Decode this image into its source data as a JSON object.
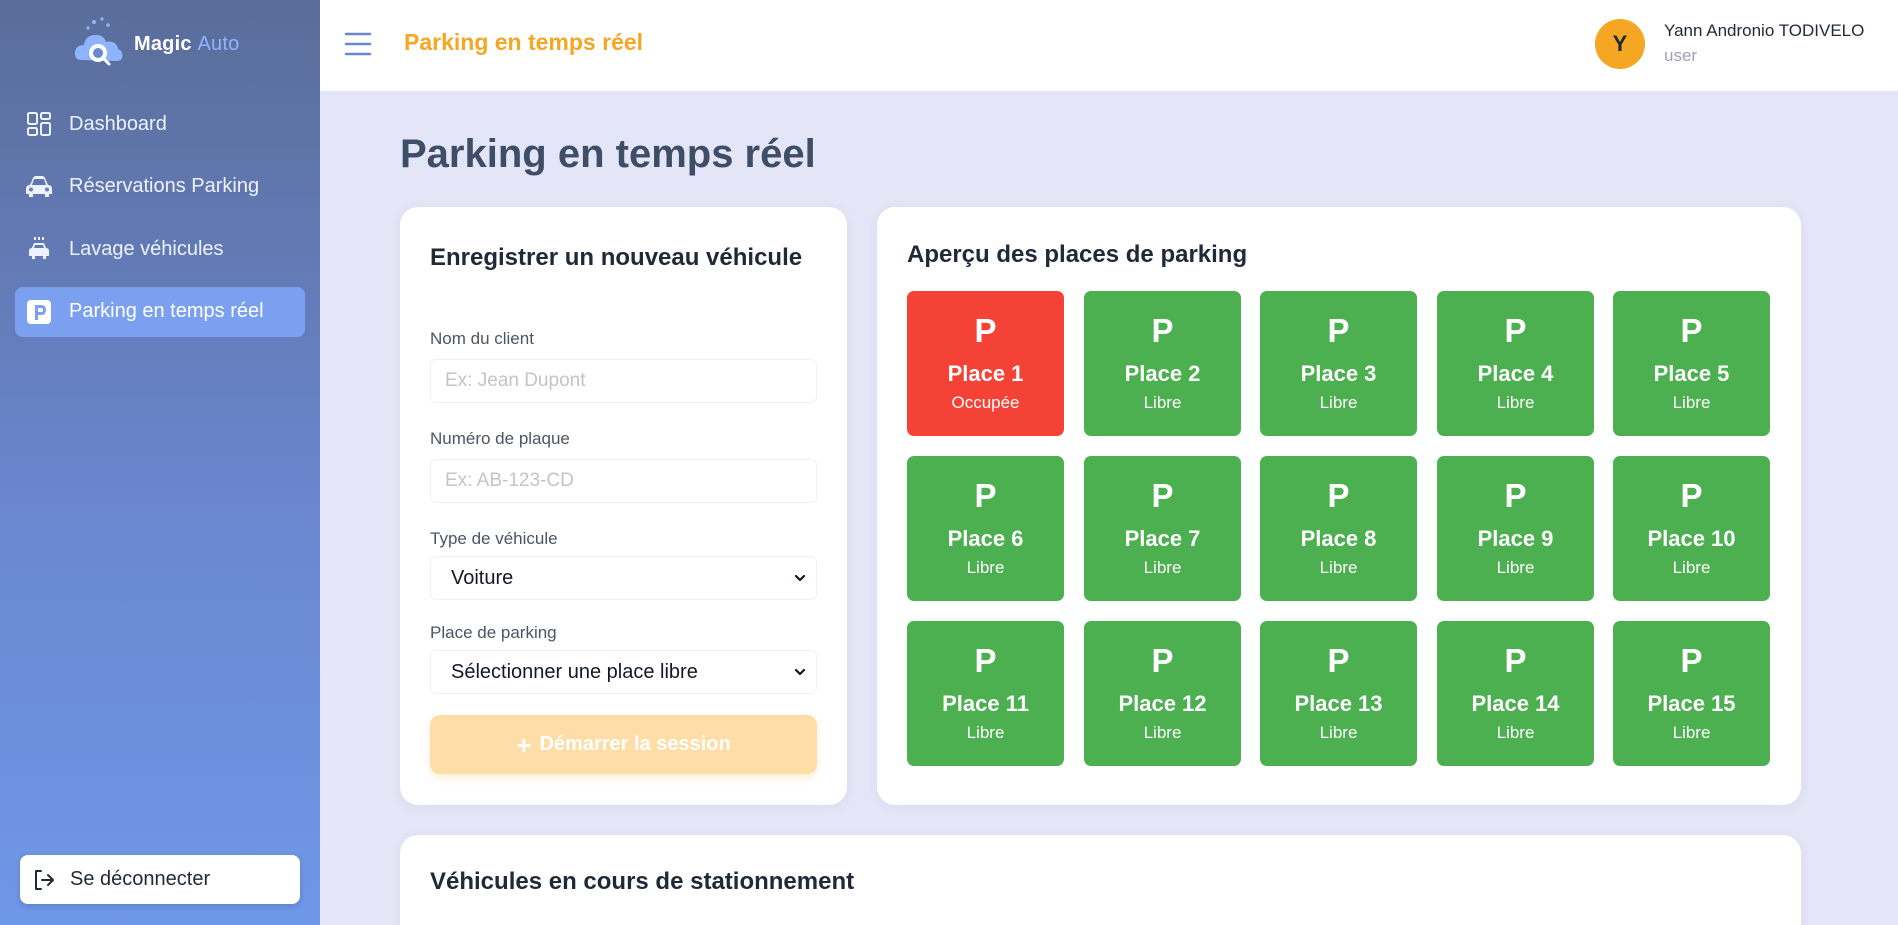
{
  "brand": {
    "name": "Magic",
    "suffix": "Auto"
  },
  "sidebar": {
    "items": [
      {
        "label": "Dashboard",
        "icon": "dashboard-icon"
      },
      {
        "label": "Réservations Parking",
        "icon": "car-icon"
      },
      {
        "label": "Lavage véhicules",
        "icon": "car-wash-icon"
      },
      {
        "label": "Parking en temps réel",
        "icon": "parking-icon",
        "active": true
      }
    ],
    "logout_label": "Se déconnecter"
  },
  "header": {
    "title": "Parking en temps réel",
    "user": {
      "initial": "Y",
      "name": "Yann Andronio TODIVELO",
      "role": "user"
    }
  },
  "main": {
    "title": "Parking en temps réel",
    "form": {
      "title": "Enregistrer un nouveau véhicule",
      "client_label": "Nom du client",
      "client_placeholder": "Ex: Jean Dupont",
      "plate_label": "Numéro de plaque",
      "plate_placeholder": "Ex: AB-123-CD",
      "type_label": "Type de véhicule",
      "type_value": "Voiture",
      "spot_label": "Place de parking",
      "spot_value": "Sélectionner une place libre",
      "submit_label": "Démarrer la session"
    },
    "overview": {
      "title": "Aperçu des places de parking",
      "symbol": "P",
      "spots": [
        {
          "name": "Place 1",
          "status": "Occupée",
          "occupied": true
        },
        {
          "name": "Place 2",
          "status": "Libre",
          "occupied": false
        },
        {
          "name": "Place 3",
          "status": "Libre",
          "occupied": false
        },
        {
          "name": "Place 4",
          "status": "Libre",
          "occupied": false
        },
        {
          "name": "Place 5",
          "status": "Libre",
          "occupied": false
        },
        {
          "name": "Place 6",
          "status": "Libre",
          "occupied": false
        },
        {
          "name": "Place 7",
          "status": "Libre",
          "occupied": false
        },
        {
          "name": "Place 8",
          "status": "Libre",
          "occupied": false
        },
        {
          "name": "Place 9",
          "status": "Libre",
          "occupied": false
        },
        {
          "name": "Place 10",
          "status": "Libre",
          "occupied": false
        },
        {
          "name": "Place 11",
          "status": "Libre",
          "occupied": false
        },
        {
          "name": "Place 12",
          "status": "Libre",
          "occupied": false
        },
        {
          "name": "Place 13",
          "status": "Libre",
          "occupied": false
        },
        {
          "name": "Place 14",
          "status": "Libre",
          "occupied": false
        },
        {
          "name": "Place 15",
          "status": "Libre",
          "occupied": false
        }
      ]
    },
    "parked": {
      "title": "Véhicules en cours de stationnement"
    }
  },
  "colors": {
    "accent": "#f5a623",
    "free": "#4caf50",
    "occupied": "#f44336",
    "sidebar_active": "#7ba0f0"
  }
}
